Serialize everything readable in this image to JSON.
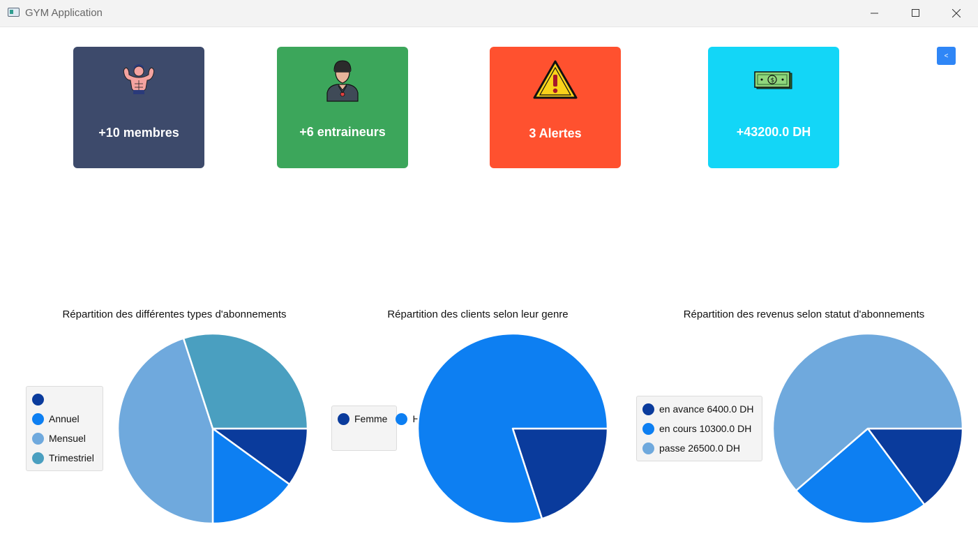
{
  "window": {
    "title": "GYM Application"
  },
  "cards": {
    "members": {
      "label": "+10 membres",
      "color": "#3d4a6b",
      "icon": "bodybuilder-icon"
    },
    "trainers": {
      "label": "+6 entraineurs",
      "color": "#3ca65b",
      "icon": "trainer-icon"
    },
    "alerts": {
      "label": "3 Alertes",
      "color": "#ff512f",
      "icon": "warning-icon"
    },
    "revenue": {
      "label": "+43200.0 DH",
      "color": "#13d6f7",
      "icon": "money-icon"
    }
  },
  "collapse_button": {
    "label": "<"
  },
  "charts": {
    "subscriptions": {
      "title": "Répartition des différentes types d'abonnements",
      "legend": [
        "",
        "Annuel",
        "Mensuel",
        "Trimestriel"
      ]
    },
    "gender": {
      "title": "Répartition des clients selon leur genre",
      "legend": [
        "Femme",
        "Homme"
      ]
    },
    "revenue": {
      "title": "Répartition des revenus selon statut d'abonnements",
      "legend": [
        "en avance 6400.0 DH",
        "en cours 10300.0 DH",
        "passe 26500.0 DH"
      ]
    }
  },
  "chart_data": [
    {
      "type": "pie",
      "title": "Répartition des différentes types d'abonnements",
      "labels": [
        "",
        "Annuel",
        "Mensuel",
        "Trimestriel"
      ],
      "values": [
        10,
        15,
        45,
        30
      ],
      "colors": [
        "#0a3b9c",
        "#0d7ff2",
        "#6fa9dd",
        "#4a9fc0"
      ]
    },
    {
      "type": "pie",
      "title": "Répartition des clients selon leur genre",
      "labels": [
        "Femme",
        "Homme"
      ],
      "values": [
        20,
        80
      ],
      "colors": [
        "#0a3b9c",
        "#0d7ff2"
      ]
    },
    {
      "type": "pie",
      "title": "Répartition des revenus selon statut d'abonnements",
      "labels": [
        "en avance 6400.0 DH",
        "en cours 10300.0 DH",
        "passe 26500.0 DH"
      ],
      "values": [
        6400,
        10300,
        26500
      ],
      "colors": [
        "#0a3b9c",
        "#0d7ff2",
        "#6fa9dd"
      ]
    }
  ]
}
